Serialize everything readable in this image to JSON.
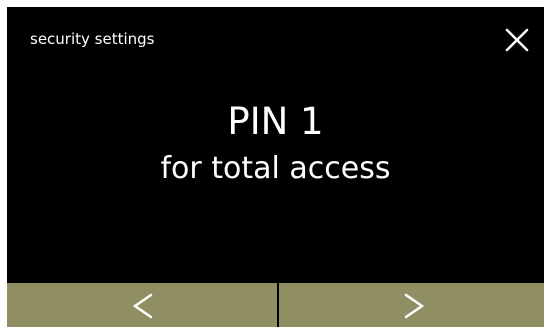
{
  "header": {
    "title": "security settings",
    "close_icon": "close-icon"
  },
  "main": {
    "title": "PIN 1",
    "subtitle": "for total access"
  },
  "nav": {
    "prev_icon": "chevron-left-icon",
    "next_icon": "chevron-right-icon"
  },
  "colors": {
    "background": "#000000",
    "text": "#ffffff",
    "nav_bar": "#8f8f63"
  }
}
